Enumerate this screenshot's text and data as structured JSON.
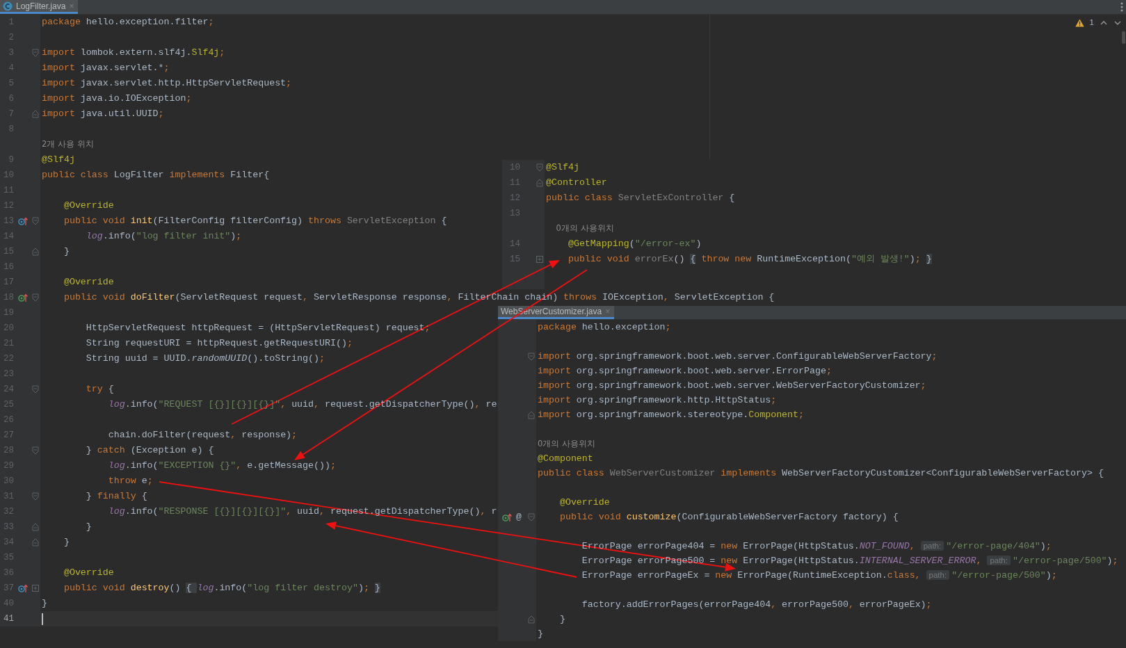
{
  "editor_tab": {
    "title": "LogFilter.java",
    "close": "×",
    "selected": true
  },
  "inspection": {
    "warnings": "1"
  },
  "main_editor": {
    "rows": [
      {
        "kind": "code",
        "num": "1",
        "current": false,
        "tokens": [
          {
            "kind": "keyword",
            "text": "package "
          },
          {
            "kind": "plain",
            "text": "hello.exception.filter"
          },
          {
            "kind": "keyword",
            "text": ";"
          }
        ]
      },
      {
        "kind": "code",
        "num": "2",
        "current": false
      },
      {
        "kind": "code",
        "num": "3",
        "current": false,
        "fold_open": true,
        "tokens": [
          {
            "kind": "keyword",
            "text": "import "
          },
          {
            "kind": "plain",
            "text": "lombok.extern.slf4j."
          },
          {
            "kind": "annotation",
            "text": "Slf4j"
          },
          {
            "kind": "keyword",
            "text": ";"
          }
        ]
      },
      {
        "kind": "code",
        "num": "4",
        "current": false,
        "tokens": [
          {
            "kind": "keyword",
            "text": "import "
          },
          {
            "kind": "plain",
            "text": "javax.servlet.*"
          },
          {
            "kind": "keyword",
            "text": ";"
          }
        ]
      },
      {
        "kind": "code",
        "num": "5",
        "current": false,
        "tokens": [
          {
            "kind": "keyword",
            "text": "import "
          },
          {
            "kind": "plain",
            "text": "javax.servlet.http.HttpServletRequest"
          },
          {
            "kind": "keyword",
            "text": ";"
          }
        ]
      },
      {
        "kind": "code",
        "num": "6",
        "current": false,
        "tokens": [
          {
            "kind": "keyword",
            "text": "import "
          },
          {
            "kind": "plain",
            "text": "java.io.IOException"
          },
          {
            "kind": "keyword",
            "text": ";"
          }
        ]
      },
      {
        "kind": "code",
        "num": "7",
        "current": false,
        "fold_close": true,
        "tokens": [
          {
            "kind": "keyword",
            "text": "import "
          },
          {
            "kind": "plain",
            "text": "java.util.UUID"
          },
          {
            "kind": "keyword",
            "text": ";"
          }
        ]
      },
      {
        "kind": "code",
        "num": "8",
        "current": false
      },
      {
        "kind": "hint",
        "text": "2개 사용 위치"
      },
      {
        "kind": "code",
        "num": "9",
        "current": false,
        "tokens": [
          {
            "kind": "annotation",
            "text": "@Slf4j"
          }
        ]
      },
      {
        "kind": "code",
        "num": "10",
        "current": false,
        "tokens": [
          {
            "kind": "keyword",
            "text": "public class "
          },
          {
            "kind": "plain",
            "text": "LogFilter "
          },
          {
            "kind": "keyword",
            "text": "implements "
          },
          {
            "kind": "plain",
            "text": "Filter{"
          }
        ]
      },
      {
        "kind": "code",
        "num": "11",
        "current": false
      },
      {
        "kind": "code",
        "num": "12",
        "current": false,
        "tokens": [
          {
            "kind": "annotation",
            "text": "    @Override"
          }
        ]
      },
      {
        "kind": "code",
        "num": "13",
        "current": false,
        "override_marker": true,
        "abstract_impl": false,
        "fold_open": true,
        "tokens": [
          {
            "kind": "keyword",
            "text": "    public void "
          },
          {
            "kind": "method",
            "text": "init"
          },
          {
            "kind": "plain",
            "text": "(FilterConfig filterConfig) "
          },
          {
            "kind": "keyword",
            "text": "throws "
          },
          {
            "kind": "unused",
            "text": "ServletException "
          },
          {
            "kind": "plain",
            "text": "{"
          }
        ]
      },
      {
        "kind": "code",
        "num": "14",
        "current": false,
        "tokens": [
          {
            "kind": "field",
            "text": "        log"
          },
          {
            "kind": "plain",
            "text": ".info("
          },
          {
            "kind": "string",
            "text": "\"log filter init\""
          },
          {
            "kind": "plain",
            "text": ")"
          },
          {
            "kind": "keyword",
            "text": ";"
          }
        ]
      },
      {
        "kind": "code",
        "num": "15",
        "current": false,
        "fold_close": true,
        "tokens": [
          {
            "kind": "plain",
            "text": "    }"
          }
        ]
      },
      {
        "kind": "code",
        "num": "16",
        "current": false
      },
      {
        "kind": "code",
        "num": "17",
        "current": false,
        "tokens": [
          {
            "kind": "annotation",
            "text": "    @Override"
          }
        ]
      },
      {
        "kind": "code",
        "num": "18",
        "current": false,
        "override_marker": true,
        "abstract_impl": true,
        "fold_open": true,
        "tokens": [
          {
            "kind": "keyword",
            "text": "    public void "
          },
          {
            "kind": "method",
            "text": "doFilter"
          },
          {
            "kind": "plain",
            "text": "(ServletRequest request"
          },
          {
            "kind": "keyword",
            "text": ", "
          },
          {
            "kind": "plain",
            "text": "ServletResponse response"
          },
          {
            "kind": "keyword",
            "text": ", "
          },
          {
            "kind": "plain",
            "text": "FilterChain chain) "
          },
          {
            "kind": "keyword",
            "text": "throws "
          },
          {
            "kind": "plain",
            "text": "IOException"
          },
          {
            "kind": "keyword",
            "text": ", "
          },
          {
            "kind": "plain",
            "text": "ServletException {"
          }
        ]
      },
      {
        "kind": "code",
        "num": "19",
        "current": false
      },
      {
        "kind": "code",
        "num": "20",
        "current": false,
        "tokens": [
          {
            "kind": "plain",
            "text": "        HttpServletRequest httpRequest = (HttpServletRequest) request"
          },
          {
            "kind": "keyword",
            "text": ";"
          }
        ]
      },
      {
        "kind": "code",
        "num": "21",
        "current": false,
        "tokens": [
          {
            "kind": "plain",
            "text": "        String requestURI = httpRequest.getRequestURI()"
          },
          {
            "kind": "keyword",
            "text": ";"
          }
        ]
      },
      {
        "kind": "code",
        "num": "22",
        "current": false,
        "tokens": [
          {
            "kind": "plain",
            "text": "        String uuid = UUID."
          },
          {
            "kind": "italic",
            "text": "randomUUID"
          },
          {
            "kind": "plain",
            "text": "().toString()"
          },
          {
            "kind": "keyword",
            "text": ";"
          }
        ]
      },
      {
        "kind": "code",
        "num": "23",
        "current": false
      },
      {
        "kind": "code",
        "num": "24",
        "current": false,
        "fold_open": true,
        "tokens": [
          {
            "kind": "keyword",
            "text": "        try "
          },
          {
            "kind": "plain",
            "text": "{"
          }
        ]
      },
      {
        "kind": "code",
        "num": "25",
        "current": false,
        "tokens": [
          {
            "kind": "field",
            "text": "            log"
          },
          {
            "kind": "plain",
            "text": ".info("
          },
          {
            "kind": "string",
            "text": "\"REQUEST [{}][{}][{}]\""
          },
          {
            "kind": "keyword",
            "text": ", "
          },
          {
            "kind": "plain",
            "text": "uuid"
          },
          {
            "kind": "keyword",
            "text": ", "
          },
          {
            "kind": "plain",
            "text": "request.getDispatcherType()"
          },
          {
            "kind": "keyword",
            "text": ", "
          },
          {
            "kind": "plain",
            "text": "re"
          }
        ]
      },
      {
        "kind": "code",
        "num": "26",
        "current": false
      },
      {
        "kind": "code",
        "num": "27",
        "current": false,
        "tokens": [
          {
            "kind": "plain",
            "text": "            chain.doFilter(request"
          },
          {
            "kind": "keyword",
            "text": ", "
          },
          {
            "kind": "plain",
            "text": "response)"
          },
          {
            "kind": "keyword",
            "text": ";"
          }
        ]
      },
      {
        "kind": "code",
        "num": "28",
        "current": false,
        "fold_open": true,
        "tokens": [
          {
            "kind": "plain",
            "text": "        } "
          },
          {
            "kind": "keyword",
            "text": "catch "
          },
          {
            "kind": "plain",
            "text": "(Exception e) {"
          }
        ]
      },
      {
        "kind": "code",
        "num": "29",
        "current": false,
        "tokens": [
          {
            "kind": "field",
            "text": "            log"
          },
          {
            "kind": "plain",
            "text": ".info("
          },
          {
            "kind": "string",
            "text": "\"EXCEPTION {}\""
          },
          {
            "kind": "keyword",
            "text": ", "
          },
          {
            "kind": "plain",
            "text": "e.getMessage())"
          },
          {
            "kind": "keyword",
            "text": ";"
          }
        ]
      },
      {
        "kind": "code",
        "num": "30",
        "current": false,
        "tokens": [
          {
            "kind": "keyword",
            "text": "            throw "
          },
          {
            "kind": "plain",
            "text": "e"
          },
          {
            "kind": "keyword",
            "text": ";"
          }
        ]
      },
      {
        "kind": "code",
        "num": "31",
        "current": false,
        "fold_open": true,
        "tokens": [
          {
            "kind": "plain",
            "text": "        } "
          },
          {
            "kind": "keyword",
            "text": "finally "
          },
          {
            "kind": "plain",
            "text": "{"
          }
        ]
      },
      {
        "kind": "code",
        "num": "32",
        "current": false,
        "tokens": [
          {
            "kind": "field",
            "text": "            log"
          },
          {
            "kind": "plain",
            "text": ".info("
          },
          {
            "kind": "string",
            "text": "\"RESPONSE [{}][{}][{}]\""
          },
          {
            "kind": "keyword",
            "text": ", "
          },
          {
            "kind": "plain",
            "text": "uuid"
          },
          {
            "kind": "keyword",
            "text": ", "
          },
          {
            "kind": "plain",
            "text": "request.getDispatcherType()"
          },
          {
            "kind": "keyword",
            "text": ", "
          },
          {
            "kind": "plain",
            "text": "r"
          }
        ]
      },
      {
        "kind": "code",
        "num": "33",
        "current": false,
        "fold_close": true,
        "tokens": [
          {
            "kind": "plain",
            "text": "        }"
          }
        ]
      },
      {
        "kind": "code",
        "num": "34",
        "current": false,
        "fold_close": true,
        "tokens": [
          {
            "kind": "plain",
            "text": "    }"
          }
        ]
      },
      {
        "kind": "code",
        "num": "35",
        "current": false
      },
      {
        "kind": "code",
        "num": "36",
        "current": false,
        "tokens": [
          {
            "kind": "annotation",
            "text": "    @Override"
          }
        ]
      },
      {
        "kind": "code",
        "num": "37",
        "current": false,
        "override_marker": true,
        "abstract_impl": false,
        "fold_collapsed": true,
        "tokens": [
          {
            "kind": "keyword",
            "text": "    public void "
          },
          {
            "kind": "method",
            "text": "destroy"
          },
          {
            "kind": "plain",
            "text": "() "
          },
          {
            "kind": "folded",
            "text": "{ "
          },
          {
            "kind": "field",
            "text": "log"
          },
          {
            "kind": "plain",
            "text": ".info("
          },
          {
            "kind": "string",
            "text": "\"log filter destroy\""
          },
          {
            "kind": "plain",
            "text": ")"
          },
          {
            "kind": "keyword",
            "text": "; "
          },
          {
            "kind": "folded",
            "text": "}"
          }
        ]
      },
      {
        "kind": "code",
        "num": "40",
        "current": false,
        "tokens": [
          {
            "kind": "plain",
            "text": "}"
          }
        ]
      },
      {
        "kind": "code",
        "num": "41",
        "current": true
      }
    ]
  },
  "snippet_controller": {
    "rows": [
      {
        "kind": "code",
        "num": "10",
        "fold_open": true,
        "tokens": [
          {
            "kind": "annotation",
            "text": "@Slf4j"
          }
        ]
      },
      {
        "kind": "code",
        "num": "11",
        "fold_close": true,
        "tokens": [
          {
            "kind": "annotation",
            "text": "@Controller"
          }
        ]
      },
      {
        "kind": "code",
        "num": "12",
        "tokens": [
          {
            "kind": "keyword",
            "text": "public class "
          },
          {
            "kind": "unused",
            "text": "ServletExController "
          },
          {
            "kind": "plain",
            "text": "{"
          }
        ]
      },
      {
        "kind": "code",
        "num": "13"
      },
      {
        "kind": "hint",
        "text": "    0개의 사용위치"
      },
      {
        "kind": "code",
        "num": "14",
        "tokens": [
          {
            "kind": "annotation",
            "text": "    @GetMapping"
          },
          {
            "kind": "plain",
            "text": "("
          },
          {
            "kind": "string",
            "text": "\"/error-ex\""
          },
          {
            "kind": "plain",
            "text": ")"
          }
        ]
      },
      {
        "kind": "code",
        "num": "15",
        "fold_collapsed": true,
        "tokens": [
          {
            "kind": "keyword",
            "text": "    public void "
          },
          {
            "kind": "unused",
            "text": "errorEx"
          },
          {
            "kind": "plain",
            "text": "() "
          },
          {
            "kind": "folded",
            "text": "{"
          },
          {
            "kind": "keyword",
            "text": " throw new "
          },
          {
            "kind": "plain",
            "text": "RuntimeException("
          },
          {
            "kind": "string",
            "text": "\"예외 발생!\""
          },
          {
            "kind": "plain",
            "text": ")"
          },
          {
            "kind": "keyword",
            "text": "; "
          },
          {
            "kind": "folded",
            "text": "}"
          }
        ]
      }
    ]
  },
  "snippet_customizer": {
    "tab": {
      "title": "WebServerCustomizer.java",
      "close": "×",
      "selected": true
    },
    "rows": [
      {
        "kind": "code",
        "tokens": [
          {
            "kind": "keyword",
            "text": "package "
          },
          {
            "kind": "plain",
            "text": "hello.exception"
          },
          {
            "kind": "keyword",
            "text": ";"
          }
        ]
      },
      {
        "kind": "code"
      },
      {
        "kind": "code",
        "fold_open": true,
        "tokens": [
          {
            "kind": "keyword",
            "text": "import "
          },
          {
            "kind": "plain",
            "text": "org.springframework.boot.web.server.ConfigurableWebServerFactory"
          },
          {
            "kind": "keyword",
            "text": ";"
          }
        ]
      },
      {
        "kind": "code",
        "tokens": [
          {
            "kind": "keyword",
            "text": "import "
          },
          {
            "kind": "plain",
            "text": "org.springframework.boot.web.server.ErrorPage"
          },
          {
            "kind": "keyword",
            "text": ";"
          }
        ]
      },
      {
        "kind": "code",
        "tokens": [
          {
            "kind": "keyword",
            "text": "import "
          },
          {
            "kind": "plain",
            "text": "org.springframework.boot.web.server.WebServerFactoryCustomizer"
          },
          {
            "kind": "keyword",
            "text": ";"
          }
        ]
      },
      {
        "kind": "code",
        "tokens": [
          {
            "kind": "keyword",
            "text": "import "
          },
          {
            "kind": "plain",
            "text": "org.springframework.http.HttpStatus"
          },
          {
            "kind": "keyword",
            "text": ";"
          }
        ]
      },
      {
        "kind": "code",
        "fold_close": true,
        "tokens": [
          {
            "kind": "keyword",
            "text": "import "
          },
          {
            "kind": "plain",
            "text": "org.springframework.stereotype."
          },
          {
            "kind": "annotation",
            "text": "Component"
          },
          {
            "kind": "keyword",
            "text": ";"
          }
        ]
      },
      {
        "kind": "code"
      },
      {
        "kind": "hint",
        "text": "0개의 사용위치"
      },
      {
        "kind": "code",
        "tokens": [
          {
            "kind": "annotation",
            "text": "@Component"
          }
        ]
      },
      {
        "kind": "code",
        "tokens": [
          {
            "kind": "keyword",
            "text": "public class "
          },
          {
            "kind": "unused",
            "text": "WebServerCustomizer "
          },
          {
            "kind": "keyword",
            "text": "implements "
          },
          {
            "kind": "plain",
            "text": "WebServerFactoryCustomizer<ConfigurableWebServerFactory> {"
          }
        ]
      },
      {
        "kind": "code"
      },
      {
        "kind": "code",
        "tokens": [
          {
            "kind": "annotation",
            "text": "    @Override"
          }
        ]
      },
      {
        "kind": "code",
        "override_marker": true,
        "abstract_impl": true,
        "gutter_mark": "@",
        "fold_open": true,
        "tokens": [
          {
            "kind": "keyword",
            "text": "    public void "
          },
          {
            "kind": "method",
            "text": "customize"
          },
          {
            "kind": "plain",
            "text": "(ConfigurableWebServerFactory factory) {"
          }
        ]
      },
      {
        "kind": "code"
      },
      {
        "kind": "code",
        "tokens": [
          {
            "kind": "plain",
            "text": "        ErrorPage errorPage404 = "
          },
          {
            "kind": "keyword",
            "text": "new "
          },
          {
            "kind": "plain",
            "text": "ErrorPage(HttpStatus."
          },
          {
            "kind": "constant",
            "text": "NOT_FOUND"
          },
          {
            "kind": "keyword",
            "text": ", "
          },
          {
            "kind": "inlay",
            "text": "path:"
          },
          {
            "kind": "string",
            "text": "\"/error-page/404\""
          },
          {
            "kind": "plain",
            "text": ")"
          },
          {
            "kind": "keyword",
            "text": ";"
          }
        ]
      },
      {
        "kind": "code",
        "tokens": [
          {
            "kind": "plain",
            "text": "        ErrorPage errorPage500 = "
          },
          {
            "kind": "keyword",
            "text": "new "
          },
          {
            "kind": "plain",
            "text": "ErrorPage(HttpStatus."
          },
          {
            "kind": "constant",
            "text": "INTERNAL_SERVER_ERROR"
          },
          {
            "kind": "keyword",
            "text": ", "
          },
          {
            "kind": "inlay",
            "text": "path:"
          },
          {
            "kind": "string",
            "text": "\"/error-page/500\""
          },
          {
            "kind": "plain",
            "text": ")"
          },
          {
            "kind": "keyword",
            "text": ";"
          }
        ]
      },
      {
        "kind": "code",
        "tokens": [
          {
            "kind": "plain",
            "text": "        ErrorPage errorPageEx = "
          },
          {
            "kind": "keyword",
            "text": "new "
          },
          {
            "kind": "plain",
            "text": "ErrorPage(RuntimeException."
          },
          {
            "kind": "keyword",
            "text": "class, "
          },
          {
            "kind": "inlay",
            "text": "path:"
          },
          {
            "kind": "string",
            "text": "\"/error-page/500\""
          },
          {
            "kind": "plain",
            "text": ")"
          },
          {
            "kind": "keyword",
            "text": ";"
          }
        ]
      },
      {
        "kind": "code"
      },
      {
        "kind": "code",
        "tokens": [
          {
            "kind": "plain",
            "text": "        factory.addErrorPages(errorPage404"
          },
          {
            "kind": "keyword",
            "text": ", "
          },
          {
            "kind": "plain",
            "text": "errorPage500"
          },
          {
            "kind": "keyword",
            "text": ", "
          },
          {
            "kind": "plain",
            "text": "errorPageEx)"
          },
          {
            "kind": "keyword",
            "text": ";"
          }
        ]
      },
      {
        "kind": "code",
        "fold_close": true,
        "tokens": [
          {
            "kind": "plain",
            "text": "    }"
          }
        ]
      },
      {
        "kind": "code",
        "tokens": [
          {
            "kind": "plain",
            "text": "}"
          }
        ]
      }
    ]
  }
}
